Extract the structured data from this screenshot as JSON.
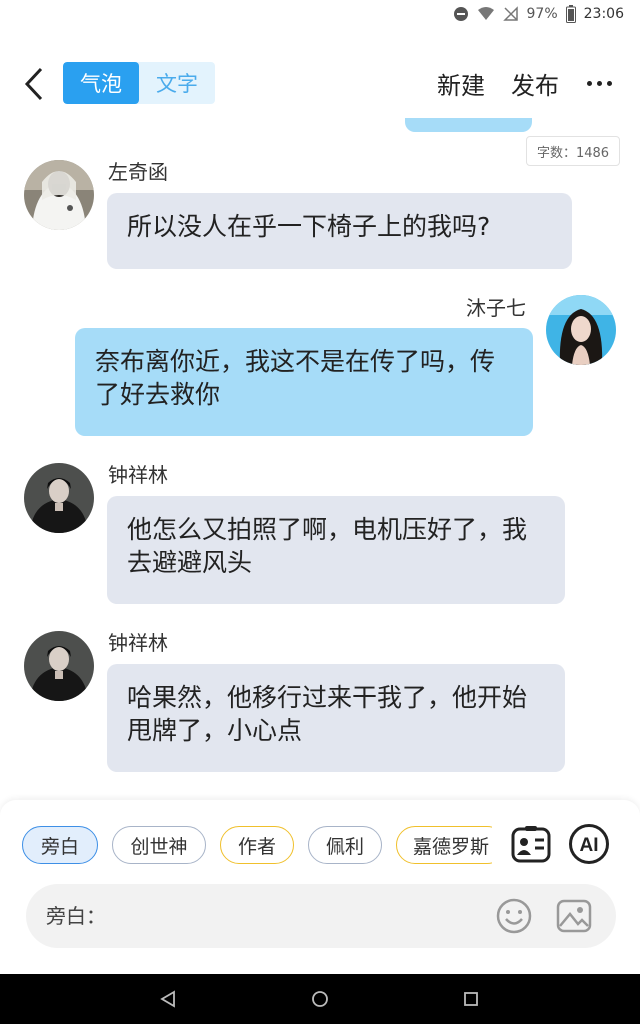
{
  "status_bar": {
    "battery": "97%",
    "time": "23:06"
  },
  "top_bar": {
    "tabs": [
      {
        "label": "气泡",
        "active": true
      },
      {
        "label": "文字",
        "active": false
      }
    ],
    "new_label": "新建",
    "publish_label": "发布"
  },
  "word_count": "字数：1486",
  "messages": [
    {
      "sender": "左奇函",
      "side": "left",
      "text": "所以没人在乎一下椅子上的我吗?"
    },
    {
      "sender": "沐子七",
      "side": "right",
      "text": "奈布离你近，我这不是在传了吗，传了好去救你"
    },
    {
      "sender": "钟祥林",
      "side": "left",
      "text": "他怎么又拍照了啊，电机压好了，我去避避风头"
    },
    {
      "sender": "钟祥林",
      "side": "left",
      "text": "哈果然，他移行过来干我了，他开始甩牌了，小心点"
    }
  ],
  "roles": [
    {
      "label": "旁白",
      "selected": true
    },
    {
      "label": "创世神",
      "selected": false
    },
    {
      "label": "作者",
      "selected": false
    },
    {
      "label": "佩利",
      "selected": false
    },
    {
      "label": "嘉德罗斯",
      "selected": false
    }
  ],
  "ai_label": "AI",
  "input": {
    "placeholder": "旁白："
  },
  "colors": {
    "accent": "#2aa0f0",
    "bubble_left": "#e2e6ef",
    "bubble_right": "#a6dcf8",
    "author_chip_border": "#f0c02c"
  }
}
